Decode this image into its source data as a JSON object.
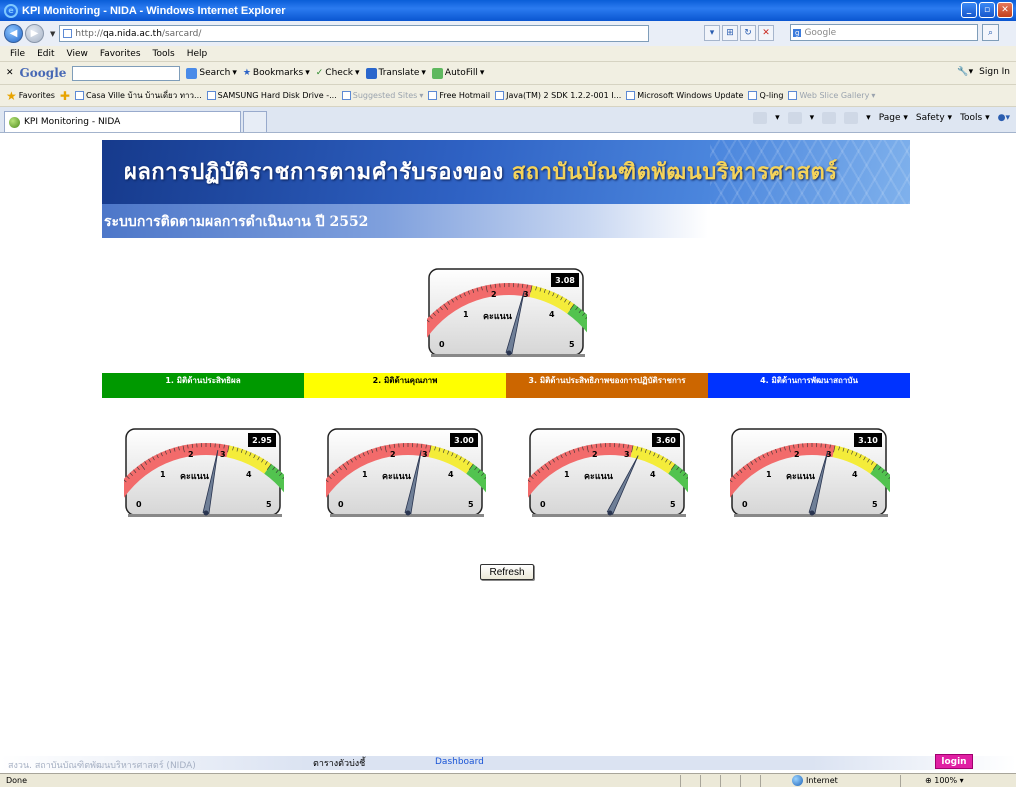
{
  "window": {
    "title": "KPI Monitoring - NIDA - Windows Internet Explorer"
  },
  "address": {
    "prefix": "http://",
    "host": "qa.nida.ac.th",
    "path": "/sarcard/"
  },
  "search": {
    "placeholder": "Google"
  },
  "menu": [
    "File",
    "Edit",
    "View",
    "Favorites",
    "Tools",
    "Help"
  ],
  "google_toolbar": {
    "logo": "Google",
    "items": [
      "Search",
      "Bookmarks",
      "Check",
      "Translate",
      "AutoFill"
    ],
    "sign_in": "Sign In"
  },
  "favorites": {
    "label": "Favorites",
    "items": [
      "Casa Ville บ้าน บ้านเดี่ยว ทาว...",
      "SAMSUNG Hard Disk Drive -...",
      "Suggested Sites",
      "Free Hotmail",
      "Java(TM) 2 SDK 1.2.2-001 I...",
      "Microsoft Windows Update",
      "Q-ling",
      "Web Slice Gallery"
    ]
  },
  "tabs": {
    "active": "KPI Monitoring - NIDA"
  },
  "command_bar": [
    "Page",
    "Safety",
    "Tools"
  ],
  "page": {
    "banner_title": "ผลการปฏิบัติราชการตามคำรับรองของ",
    "banner_org": "สถาบันบัณฑิตพัฒนบริหารศาสตร์",
    "subtitle": "ระบบการติดตามผลการดำเนินงาน ปี 2552",
    "main_gauge": {
      "value": 3.08,
      "label": "3.08",
      "center_label": "คะแนน"
    },
    "categories": [
      {
        "label": "1. มิติด้านประสิทธิผล",
        "color": "#009900",
        "text_color": "#ffffff"
      },
      {
        "label": "2. มิติด้านคุณภาพ",
        "color": "#ffff00",
        "text_color": "#000000"
      },
      {
        "label": "3. มิติด้านประสิทธิภาพของการปฏิบัติราชการ",
        "color": "#cc6600",
        "text_color": "#ffffff"
      },
      {
        "label": "4. มิติด้านการพัฒนาสถาบัน",
        "color": "#0033ff",
        "text_color": "#ffffff"
      }
    ],
    "sub_gauges": [
      {
        "value": 2.95,
        "label": "2.95"
      },
      {
        "value": 3.0,
        "label": "3.00"
      },
      {
        "value": 3.6,
        "label": "3.60"
      },
      {
        "value": 3.1,
        "label": "3.10"
      }
    ],
    "gauge_scale": [
      "0",
      "1",
      "2",
      "3",
      "4",
      "5"
    ],
    "refresh_label": "Refresh",
    "footer": {
      "copyright": "สงวน. สถาบันบัณฑิตพัฒนบริหารศาสตร์ (NIDA)",
      "nav_indicators": "ตารางตัวบ่งชี้",
      "nav_dashboard": "Dashboard",
      "login": "login"
    }
  },
  "status": {
    "text": "Done",
    "zone": "Internet",
    "zoom": "100%"
  }
}
